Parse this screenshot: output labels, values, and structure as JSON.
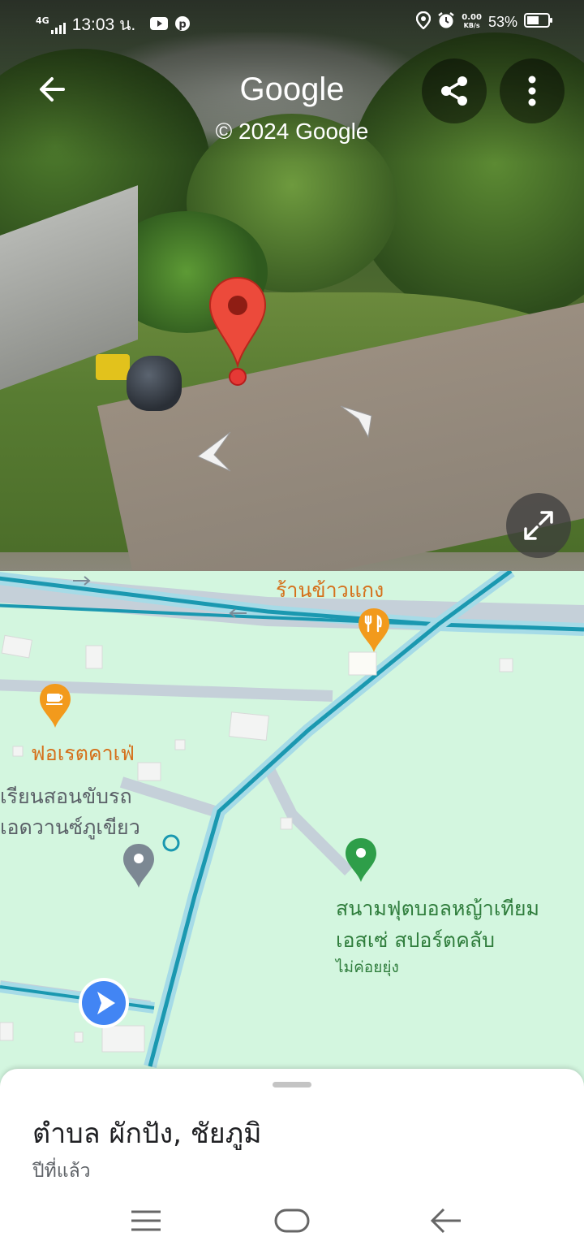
{
  "status_bar": {
    "network": "4G",
    "time": "13:03 น.",
    "speed_value": "0.00",
    "speed_unit": "KB/s",
    "battery": "53%"
  },
  "header": {
    "title": "Google",
    "copyright": "© 2024 Google"
  },
  "icons": {
    "back": "arrow-left-icon",
    "share": "share-icon",
    "more": "more-vert-icon",
    "expand": "expand-icon"
  },
  "map": {
    "restaurant_label": "ร้านข้าวแกง",
    "cafe_label": "ฟอเรตคาเฟ่",
    "school_line1": "เรียนสอนขับรถ",
    "school_line2": "เอดวานซ์ภูเขียว",
    "field_line1": "สนามฟุตบอลหญ้าเทียม",
    "field_line2": "เอสเซ่ สปอร์ตคลับ",
    "field_status": "ไม่ค่อยยุ่ง"
  },
  "sheet": {
    "title": "ตำบล ผักปัง, ชัยภูมิ",
    "subtitle": "ปีที่แล้ว"
  },
  "colors": {
    "map_bg": "#d3f6df",
    "route": "#1a98b0",
    "food_pin": "#f29a1c",
    "park_pin": "#2e9e49",
    "location_dot": "#4285f4"
  }
}
